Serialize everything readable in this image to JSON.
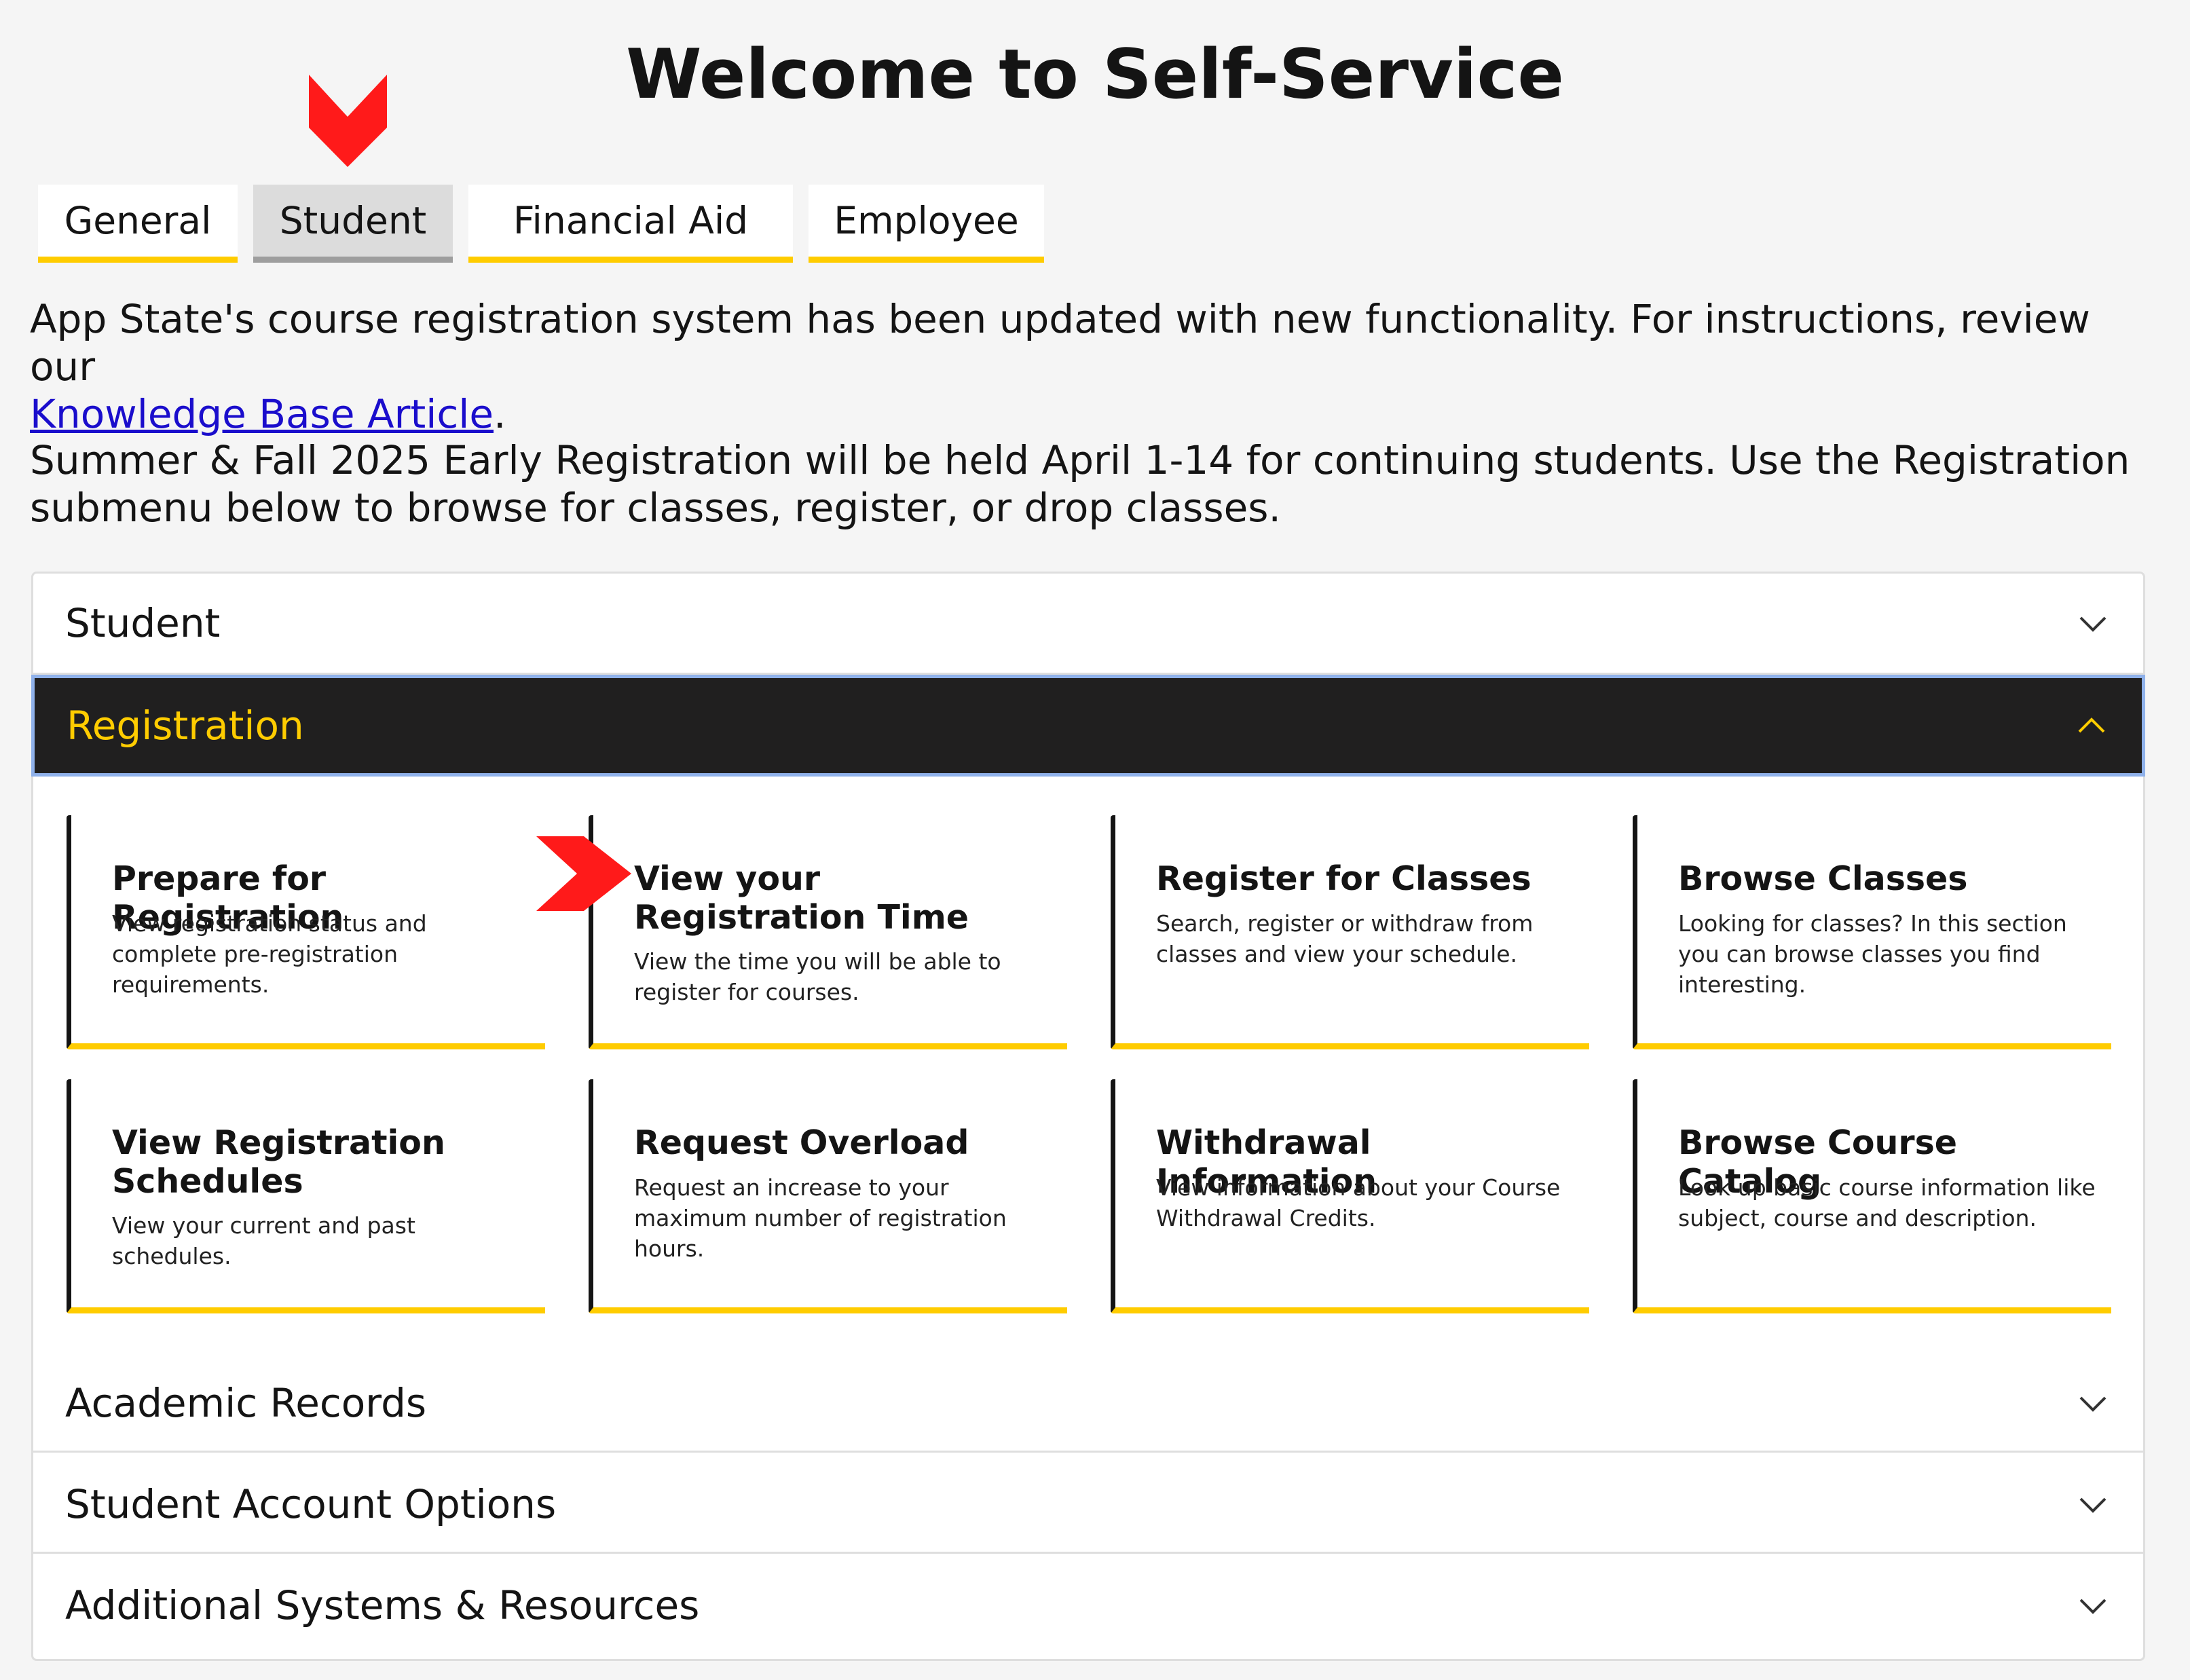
{
  "page": {
    "title": "Welcome to Self-Service"
  },
  "tabs": [
    {
      "label": "General",
      "active": false
    },
    {
      "label": "Student",
      "active": true
    },
    {
      "label": "Financial Aid",
      "active": false
    },
    {
      "label": "Employee",
      "active": false
    }
  ],
  "intro": {
    "paragraph1_text": "App State's course registration system has been updated with new functionality. For instructions, review our",
    "paragraph1_link": "Knowledge Base Article",
    "paragraph1_end": ".",
    "paragraph2_text": "Summer & Fall 2025 Early Registration will be held April 1-14 for continuing students. Use the Registration submenu below to browse for classes, register, or drop classes."
  },
  "accordion": {
    "sections": [
      {
        "label": "Student",
        "expanded": false
      },
      {
        "label": "Registration",
        "expanded": true
      },
      {
        "label": "Academic Records",
        "expanded": false
      },
      {
        "label": "Student Account Options",
        "expanded": false
      },
      {
        "label": "Additional Systems & Resources",
        "expanded": false
      }
    ],
    "registration_cards": [
      {
        "title": "Prepare for Registration",
        "description": "View registration status and complete pre-registration requirements."
      },
      {
        "title": "View your Registration Time",
        "description": "View the time you will be able to register for courses."
      },
      {
        "title": "Register for Classes",
        "description": "Search, register or withdraw from classes and view your schedule."
      },
      {
        "title": "Browse Classes",
        "description": "Looking for classes? In this section you can browse classes you find interesting."
      },
      {
        "title": "View Registration Schedules",
        "description": "View your current and past schedules."
      },
      {
        "title": "Request Overload",
        "description": "Request an increase to your maximum number of registration hours."
      },
      {
        "title": "Withdrawal Information",
        "description": "View information about your Course Withdrawal Credits."
      },
      {
        "title": "Browse Course Catalog",
        "description": "Look up basic course information like subject, course and description."
      }
    ]
  },
  "colors": {
    "accent_gold": "#ffcc00",
    "dark_bar": "#201f1f",
    "annotation_arrow": "#ff1a1a",
    "link": "#1a0dcc"
  },
  "icons": {
    "annotation_down": "down-arrow-annotation-icon",
    "annotation_right": "right-arrow-annotation-icon",
    "collapsed": "chevron-down-icon",
    "expanded": "chevron-up-icon"
  }
}
